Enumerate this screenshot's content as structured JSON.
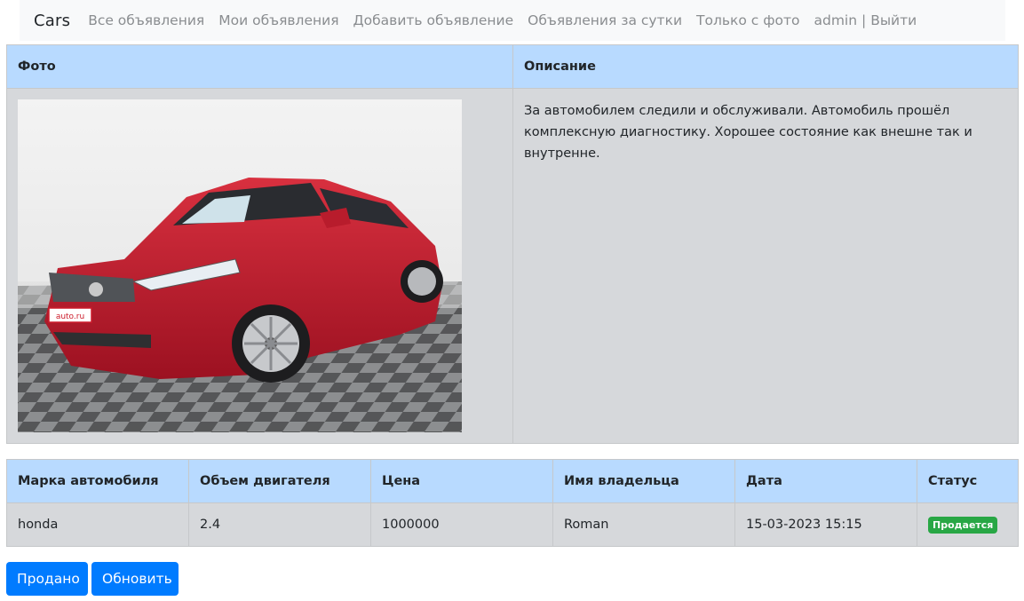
{
  "navbar": {
    "brand": "Cars",
    "links": [
      "Все объявления",
      "Мои объявления",
      "Добавить объявление",
      "Объявления за сутки",
      "Только с фото"
    ],
    "user": "admin",
    "separator": "|",
    "logout": "Выйти"
  },
  "details": {
    "headers": {
      "photo": "Фото",
      "description": "Описание"
    },
    "description": "За автомобилем следили и обслуживали. Автомобиль прошёл комплексную диагностику. Хорошее состояние как внешне так и внутренне.",
    "photo_alt": "red-car-photo",
    "plate_text": "auto.ru"
  },
  "specs": {
    "headers": [
      "Марка автомобиля",
      "Объем двигателя",
      "Цена",
      "Имя владельца",
      "Дата",
      "Статус"
    ],
    "row": {
      "brand": "honda",
      "engine": "2.4",
      "price": "1000000",
      "owner": "Roman",
      "date": "15-03-2023 15:15",
      "status": "Продается"
    }
  },
  "actions": {
    "sold": "Продано",
    "refresh": "Обновить"
  },
  "colors": {
    "header": "#b8daff",
    "row": "#d6d8db",
    "primary": "#007bff",
    "success": "#28a745"
  }
}
